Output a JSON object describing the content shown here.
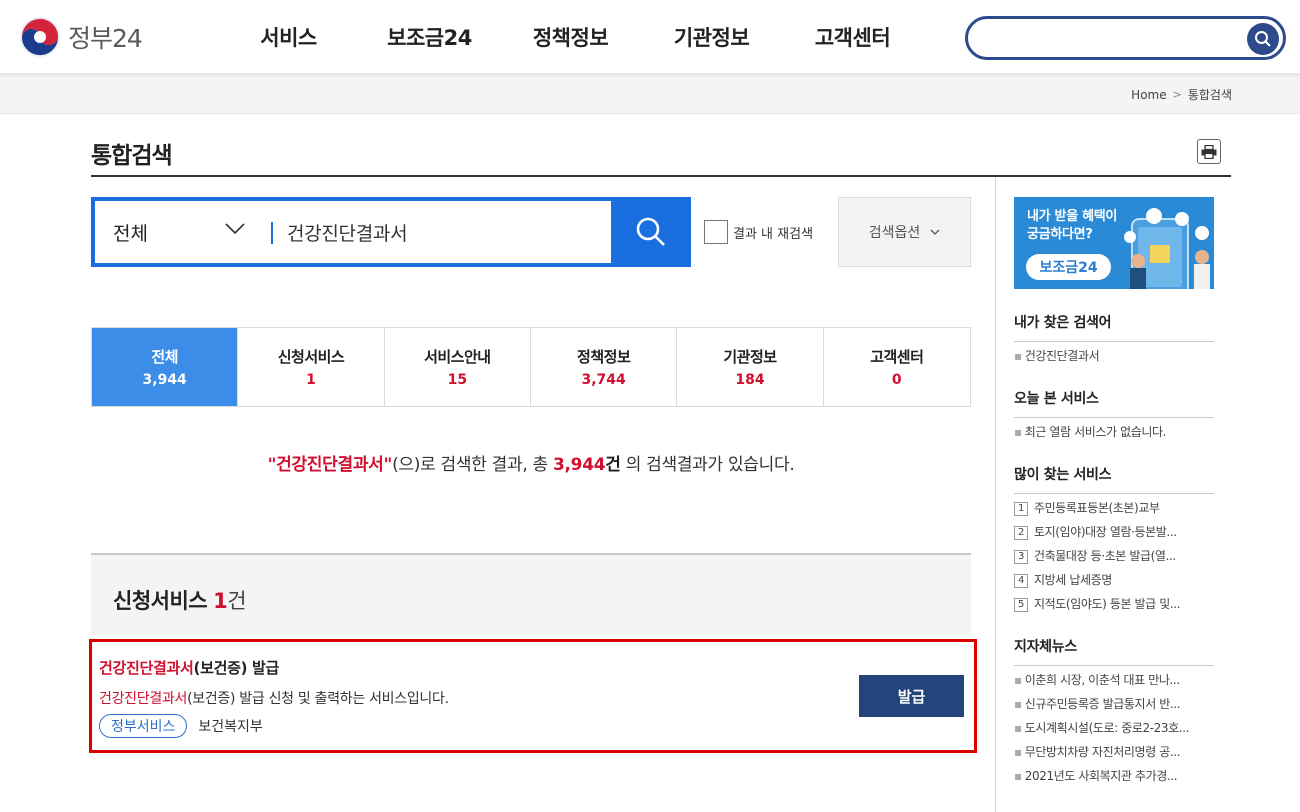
{
  "header": {
    "logo_text": "정부24",
    "nav": [
      "서비스",
      "보조금24",
      "정책정보",
      "기관정보",
      "고객센터"
    ],
    "search_value": ""
  },
  "breadcrumb": {
    "home": "Home",
    "current": "통합검색"
  },
  "page": {
    "title": "통합검색"
  },
  "search": {
    "scope": "전체",
    "query": "건강진단결과서",
    "recheck_label": "결과 내 재검색",
    "options_label": "검색옵션"
  },
  "tabs": [
    {
      "label": "전체",
      "count": "3,944",
      "active": true
    },
    {
      "label": "신청서비스",
      "count": "1"
    },
    {
      "label": "서비스안내",
      "count": "15"
    },
    {
      "label": "정책정보",
      "count": "3,744"
    },
    {
      "label": "기관정보",
      "count": "184"
    },
    {
      "label": "고객센터",
      "count": "0"
    }
  ],
  "result_summary": {
    "open_quote": "\"",
    "keyword": "건강진단결과서",
    "close_quote": "\"",
    "mid": "(으)로 검색한 결과, 총 ",
    "total": "3,944",
    "unit": "건",
    "tail": " 의 검색결과가 있습니다."
  },
  "section": {
    "title": "신청서비스",
    "count": "1",
    "unit": "건"
  },
  "result_item": {
    "title_highlight": "건강진단결과서",
    "title_rest": "(보건증) 발급",
    "desc_highlight": "건강진단결과서",
    "desc_rest": "(보건증) 발급 신청 및 출력하는 서비스입니다.",
    "badge": "정부서비스",
    "agency": "보건복지부",
    "button": "발급"
  },
  "sidebar": {
    "banner": {
      "line1": "내가 받을 혜택이",
      "line2": "궁금하다면?",
      "pill": "보조금24"
    },
    "my_keywords": {
      "title": "내가 찾은 검색어",
      "items": [
        "건강진단결과서"
      ]
    },
    "today_services": {
      "title": "오늘 본 서비스",
      "items": [
        "최근 열람 서비스가 없습니다."
      ]
    },
    "popular": {
      "title": "많이 찾는 서비스",
      "items": [
        {
          "rank": "1",
          "label": "주민등록표등본(초본)교부"
        },
        {
          "rank": "2",
          "label": "토지(임야)대장 열람·등본발..."
        },
        {
          "rank": "3",
          "label": "건축물대장 등·초본 발급(열..."
        },
        {
          "rank": "4",
          "label": "지방세 납세증명"
        },
        {
          "rank": "5",
          "label": "지적도(임야도) 등본 발급 및..."
        }
      ]
    },
    "local_news": {
      "title": "지자체뉴스",
      "items": [
        "이춘희 시장, 이춘석 대표 만나...",
        "신규주민등록증 발급통지서 반...",
        "도시계획시설(도로: 중로2-23호...",
        "무단방치차량 자진처리명령 공...",
        "2021년도 사회복지관 추가경..."
      ]
    }
  }
}
